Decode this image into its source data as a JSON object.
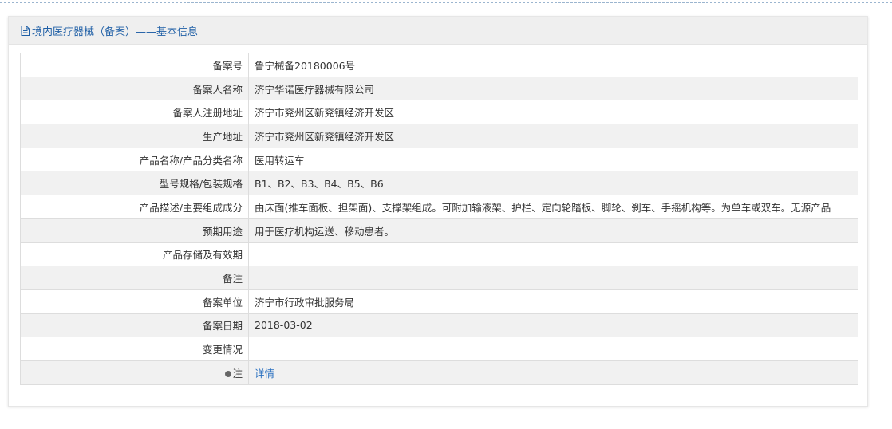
{
  "header": {
    "title": "境内医疗器械（备案）——基本信息",
    "icon": "document-icon"
  },
  "rows": [
    {
      "label": "备案号",
      "value": "鲁宁械备20180006号"
    },
    {
      "label": "备案人名称",
      "value": "济宁华诺医疗器械有限公司"
    },
    {
      "label": "备案人注册地址",
      "value": "济宁市兖州区新兖镇经济开发区"
    },
    {
      "label": "生产地址",
      "value": "济宁市兖州区新兖镇经济开发区"
    },
    {
      "label": "产品名称/产品分类名称",
      "value": "医用转运车"
    },
    {
      "label": "型号规格/包装规格",
      "value": "B1、B2、B3、B4、B5、B6"
    },
    {
      "label": "产品描述/主要组成成分",
      "value": "由床面(推车面板、担架面)、支撑架组成。可附加输液架、护栏、定向轮踏板、脚轮、刹车、手摇机构等。为单车或双车。无源产品"
    },
    {
      "label": "预期用途",
      "value": "用于医疗机构运送、移动患者。"
    },
    {
      "label": "产品存储及有效期",
      "value": ""
    },
    {
      "label": "备注",
      "value": ""
    },
    {
      "label": "备案单位",
      "value": "济宁市行政审批服务局"
    },
    {
      "label": "备案日期",
      "value": "2018-03-02"
    },
    {
      "label": "变更情况",
      "value": ""
    }
  ],
  "note_row": {
    "label": "注",
    "link": "详情",
    "icon": "note-icon"
  },
  "colors": {
    "title": "#1f5fa6",
    "link": "#2a70c0",
    "row_alt": "#f1f1f1",
    "header_bg": "#efefef"
  }
}
